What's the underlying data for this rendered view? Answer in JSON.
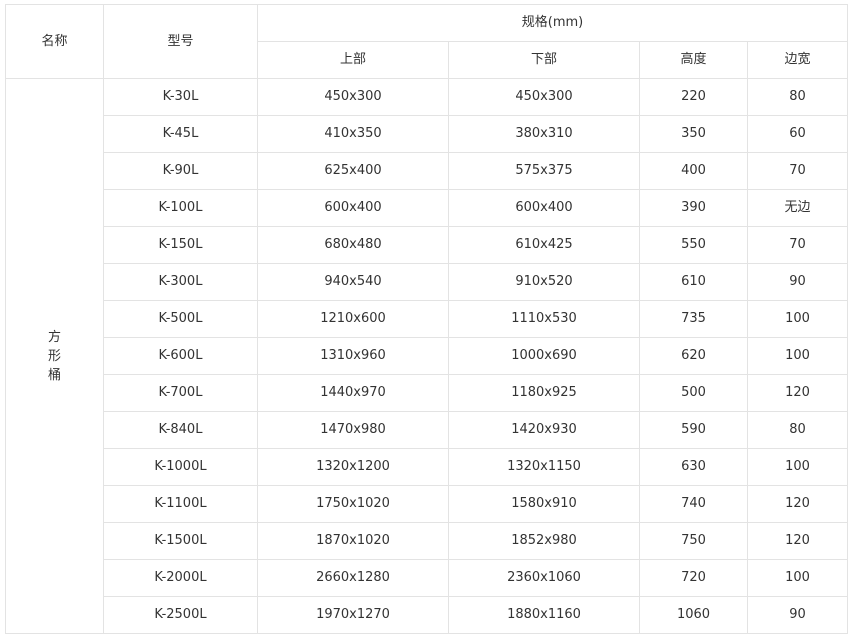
{
  "header": {
    "name": "名称",
    "model": "型号",
    "spec": "规格(mm)",
    "top": "上部",
    "bottom": "下部",
    "height": "高度",
    "edge": "边宽"
  },
  "category": "方形桶",
  "rows": [
    {
      "model": "K-30L",
      "top": "450x300",
      "bottom": "450x300",
      "height": "220",
      "edge": "80"
    },
    {
      "model": "K-45L",
      "top": "410x350",
      "bottom": "380x310",
      "height": "350",
      "edge": "60"
    },
    {
      "model": "K-90L",
      "top": "625x400",
      "bottom": "575x375",
      "height": "400",
      "edge": "70"
    },
    {
      "model": "K-100L",
      "top": "600x400",
      "bottom": "600x400",
      "height": "390",
      "edge": "无边"
    },
    {
      "model": "K-150L",
      "top": "680x480",
      "bottom": "610x425",
      "height": "550",
      "edge": "70"
    },
    {
      "model": "K-300L",
      "top": "940x540",
      "bottom": "910x520",
      "height": "610",
      "edge": "90"
    },
    {
      "model": "K-500L",
      "top": "1210x600",
      "bottom": "1110x530",
      "height": "735",
      "edge": "100"
    },
    {
      "model": "K-600L",
      "top": "1310x960",
      "bottom": "1000x690",
      "height": "620",
      "edge": "100"
    },
    {
      "model": "K-700L",
      "top": "1440x970",
      "bottom": "1180x925",
      "height": "500",
      "edge": "120"
    },
    {
      "model": "K-840L",
      "top": "1470x980",
      "bottom": "1420x930",
      "height": "590",
      "edge": "80"
    },
    {
      "model": "K-1000L",
      "top": "1320x1200",
      "bottom": "1320x1150",
      "height": "630",
      "edge": "100"
    },
    {
      "model": "K-1100L",
      "top": "1750x1020",
      "bottom": "1580x910",
      "height": "740",
      "edge": "120"
    },
    {
      "model": "K-1500L",
      "top": "1870x1020",
      "bottom": "1852x980",
      "height": "750",
      "edge": "120"
    },
    {
      "model": "K-2000L",
      "top": "2660x1280",
      "bottom": "2360x1060",
      "height": "720",
      "edge": "100"
    },
    {
      "model": "K-2500L",
      "top": "1970x1270",
      "bottom": "1880x1160",
      "height": "1060",
      "edge": "90"
    }
  ]
}
